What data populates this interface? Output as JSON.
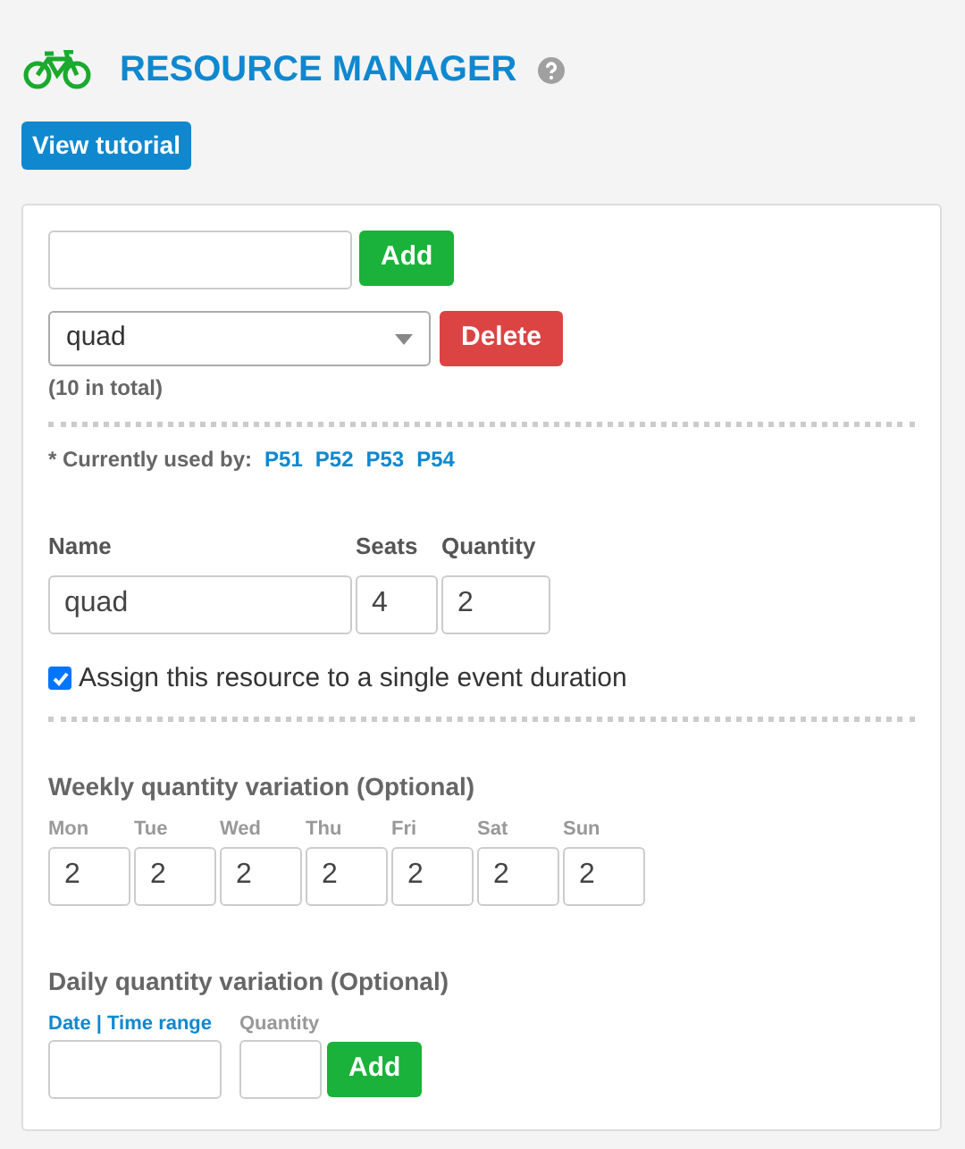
{
  "header": {
    "title": "RESOURCE MANAGER",
    "tutorial_button": "View tutorial"
  },
  "new_resource": {
    "button": "Add"
  },
  "resource_select": {
    "value": "quad",
    "button": "Delete",
    "total": "(10 in total)"
  },
  "used_by": {
    "label": "* Currently used by:",
    "links": [
      "P51",
      "P52",
      "P53",
      "P54"
    ]
  },
  "fields": [
    {
      "label": "Name",
      "value": "quad"
    },
    {
      "label": "Seats",
      "value": "4"
    },
    {
      "label": "Quantity",
      "value": "2"
    }
  ],
  "single_event": {
    "label": "Assign this resource to a single event duration",
    "checked": true
  },
  "weekly": {
    "title": "Weekly quantity variation (Optional)",
    "days": [
      {
        "label": "Mon",
        "value": "2"
      },
      {
        "label": "Tue",
        "value": "2"
      },
      {
        "label": "Wed",
        "value": "2"
      },
      {
        "label": "Thu",
        "value": "2"
      },
      {
        "label": "Fri",
        "value": "2"
      },
      {
        "label": "Sat",
        "value": "2"
      },
      {
        "label": "Sun",
        "value": "2"
      }
    ]
  },
  "daily": {
    "title": "Daily quantity variation (Optional)",
    "date_label": "Date | Time range",
    "quantity_label": "Quantity",
    "button": "Add"
  }
}
